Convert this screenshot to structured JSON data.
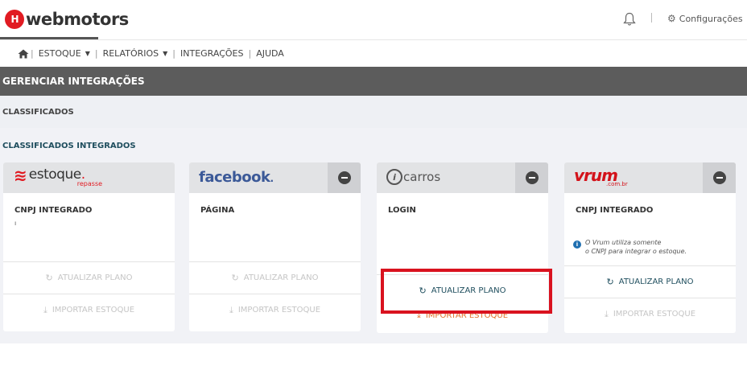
{
  "header": {
    "logo_badge": "H",
    "logo_text": "webmotors",
    "config_label": "Configurações"
  },
  "nav": {
    "items": [
      {
        "label": "ESTOQUE",
        "has_caret": true
      },
      {
        "label": "RELATÓRIOS",
        "has_caret": true
      },
      {
        "label": "INTEGRAÇÕES",
        "has_caret": false
      },
      {
        "label": "AJUDA",
        "has_caret": false
      }
    ],
    "separator": "|"
  },
  "page_title": "GERENCIAR INTEGRAÇÕES",
  "sub_title": "CLASSIFICADOS",
  "section_label": "CLASSIFICADOS INTEGRADOS",
  "cards": [
    {
      "brand": "estoque",
      "logo_main": "estoque",
      "logo_dot": ".",
      "logo_sub": "repasse",
      "field_label": "CNPJ INTEGRADO",
      "field_value": "ı",
      "update_label": "ATUALIZAR PLANO",
      "import_label": "IMPORTAR ESTOQUE",
      "state": "disabled"
    },
    {
      "brand": "facebook",
      "logo_main": "facebook",
      "logo_dot": ".",
      "field_label": "PÁGINA",
      "update_label": "ATUALIZAR PLANO",
      "import_label": "IMPORTAR ESTOQUE",
      "state": "disabled"
    },
    {
      "brand": "icarros",
      "logo_icon": "i",
      "logo_main": "carros",
      "field_label": "LOGIN",
      "update_label": "ATUALIZAR PLANO",
      "import_label": "IMPORTAR ESTOQUE",
      "state": "active"
    },
    {
      "brand": "vrum",
      "logo_main": "vrum",
      "logo_sub": ".com.br",
      "field_label": "CNPJ INTEGRADO",
      "note_icon": "i",
      "note_line1": "O Vrum utiliza somente",
      "note_line2": "o CNPJ para integrar o estoque.",
      "update_label": "ATUALIZAR PLANO",
      "import_label": "IMPORTAR ESTOQUE",
      "state": "partial"
    }
  ],
  "colors": {
    "title_bar": "#5c5c5c",
    "accent_teal": "#1f4e5e",
    "accent_orange": "#e2712a",
    "highlight_red": "#d9121f",
    "brand_red": "#e11b22"
  },
  "icons": {
    "bell": "bell-icon",
    "gear": "gear-icon",
    "home": "home-icon",
    "refresh": "refresh-icon",
    "download": "download-icon",
    "remove": "minus-circle-icon",
    "info": "info-icon"
  }
}
